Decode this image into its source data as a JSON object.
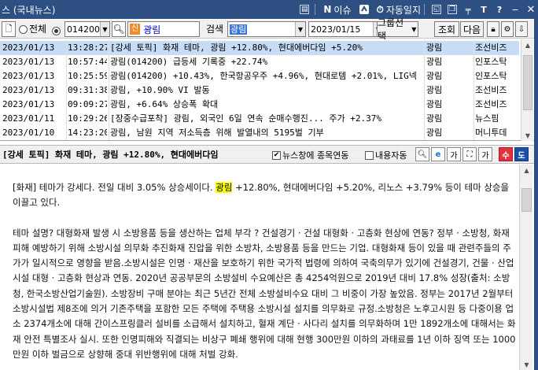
{
  "window": {
    "title": "스 (국내뉴스)",
    "buttons": {
      "issue": "이슈",
      "auto_log": "자동일지"
    },
    "icons": [
      "window-icon",
      "n-logo-icon",
      "clock-icon",
      "tile-icon",
      "restore-icon",
      "pin-icon",
      "font-t-icon",
      "help-icon",
      "minimize-icon",
      "close-icon"
    ]
  },
  "toolbar": {
    "radio_all": "전체",
    "code_value": "014200",
    "new_badge": "신",
    "stock_name": "광림",
    "search_label": "검색",
    "keyword_value": "광림",
    "date_value": "2023/01/15",
    "group_select": "그룹선택",
    "inquire": "조회",
    "next": "다음"
  },
  "news_list": [
    {
      "date": "2023/01/13",
      "time": "13:28:27",
      "title": "[강세 토픽] 화재 테마, 광림 +12.80%, 현대에버다임 +5.20%",
      "name": "광림",
      "source": "조선비즈"
    },
    {
      "date": "2023/01/13",
      "time": "10:57:44",
      "title": "광림(014200) 급등세 기록중 +22.74%",
      "name": "광림",
      "source": "인포스탁"
    },
    {
      "date": "2023/01/13",
      "time": "10:25:59",
      "title": "광림(014200)  +10.43%, 한국항공우주 +4.96%, 현대로템 +2.01%, LIG넥",
      "name": "광림",
      "source": "인포스탁"
    },
    {
      "date": "2023/01/13",
      "time": "09:31:38",
      "title": "광림, +10.90% VI 발동",
      "name": "광림",
      "source": "조선비즈"
    },
    {
      "date": "2023/01/13",
      "time": "09:09:27",
      "title": "광림, +6.64% 상승폭 확대",
      "name": "광림",
      "source": "조선비즈"
    },
    {
      "date": "2023/01/11",
      "time": "10:29:26",
      "title": "[장중수급포착] 광림, 외국인 6일 연속 순매수행진... 주가 +2.37%",
      "name": "광림",
      "source": "뉴스핌"
    },
    {
      "date": "2023/01/10",
      "time": "14:23:20",
      "title": "광림, 남원 지역 저소득층 위해 발열내의 5195벌 기부",
      "name": "광림",
      "source": "머니투데"
    }
  ],
  "article": {
    "header_title": "[강세 토픽] 화재 테마, 광림 +12.80%, 현대에버다임",
    "chk_link": "뉴스창에 종목연동",
    "chk_content": "내용자동",
    "para1_pre": "[화재] 테마가 강세다. 전일 대비 3.05% 상승세이다. ",
    "para1_hl": "광림",
    "para1_post": " +12.80%, 현대에버다임 +5.20%, 리노스 +3.79% 등이 테마 상승을 이끌고 있다.",
    "para2": "테마 설명? 대형화재 발생 시 소방용품 등을 생산하는 업체 부각 ? 건설경기 · 건설 대형화 · 고층화 현상에 연동? 정부 · 소방청, 화재 피해 예방하기 위해 소방시설 의무화 추진화재 진압을 위한 소방차, 소방용품 등을 만드는 기업. 대형화재 등이 있을 때 관련주들의 주가가 일시적으로 영향을 받음.소방시설은 인명 · 재산을 보호하기 위한 국가적 법령에 의하여 국축의무가 있기에 건설경기, 건물 · 산업시설 대형 · 고층화 현상과 연동. 2020년 공공부문의 소방설비 수요예산은 총 4254억원으로 2019년 대비 17.8% 성장(출처: 소방청, 한국소방산업기술원). 소방장비 구매 분야는 최근 5년간 전체 소방설비수요 대비 그 비중이 가장 높았음. 정부는 2017년 2월부터 소방시설법 제8조에 의거 기존주택을 포함한 모든 주택에 주택용 소방시설 설치를 의무화로 규정.소방청은 노후고시원 등 다중이용 업소 2374개소에 대해 간이스프링클러 설비를 소급해서 설치하고, 혈재 계단 · 사다리 설치를 의무화하며 1만 1892개소에 대해서는 화재 안전 특별조사 실시. 또한 인명피해와 직결되는 비상구 폐쇄 행위에 대해 현행 300만원 이하의 과태료를 1년 이하 징역 또는 1000만원 이하 벌금으로 상향해 중대 위반행위에 대해 처벌 강화."
  }
}
